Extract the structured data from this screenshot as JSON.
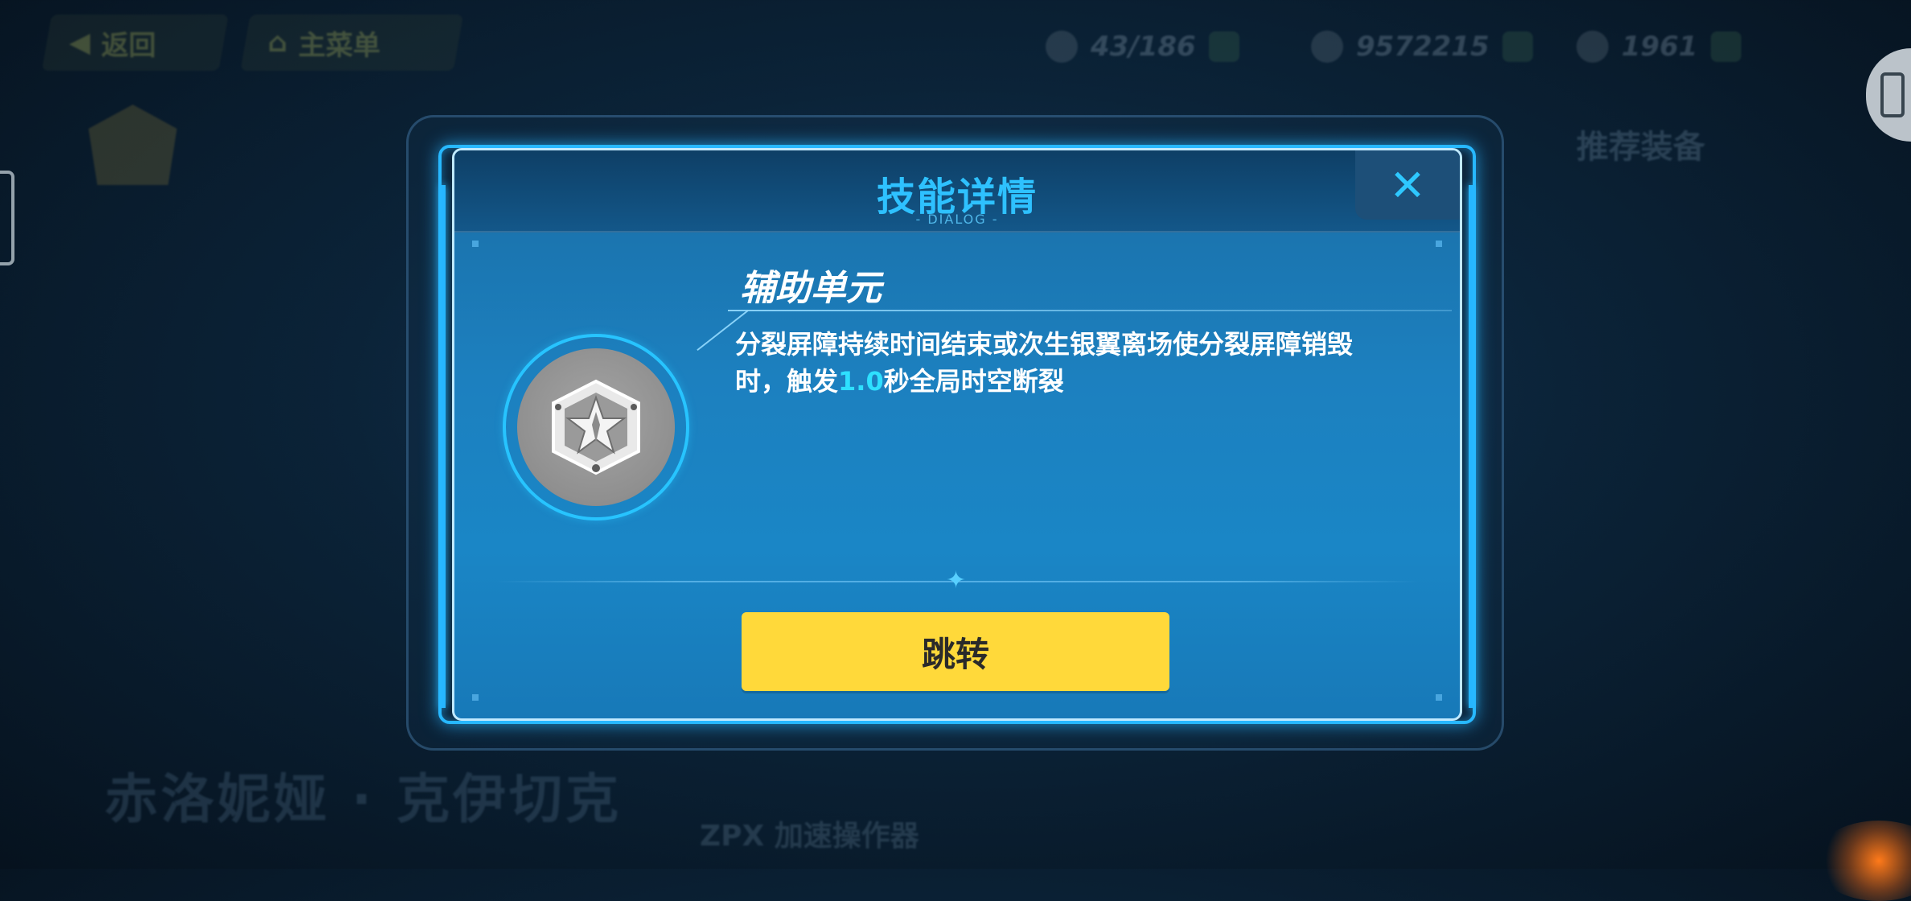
{
  "background": {
    "back_button": "返回",
    "main_menu_button": "主菜单",
    "resources": [
      "43/186",
      "9572215",
      "1961"
    ],
    "right_panel_title": "推荐装备",
    "character_name": "赤洛妮娅 · 克伊切克",
    "bottom_text": "ZPX 加速操作器"
  },
  "dialog": {
    "title": "技能详情",
    "subtitle": "- DIALOG -",
    "close_label": "✕",
    "skill_name": "辅助单元",
    "description_before": "分裂屏障持续时间结束或次生银翼离场使分裂屏障销毁时，触发",
    "description_highlight": "1.0",
    "description_after": "秒全局时空断裂",
    "icon": "shield-cube-icon",
    "jump_button": "跳转"
  },
  "colors": {
    "accent_blue": "#27b8ff",
    "title_blue": "#2ec1ff",
    "highlight": "#2ee0ff",
    "button_yellow": "#ffd93a"
  }
}
